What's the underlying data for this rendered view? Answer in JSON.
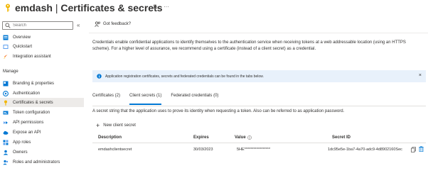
{
  "header": {
    "app_name": "emdash",
    "separator": "|",
    "page_title": "Certificates & secrets",
    "more": "···"
  },
  "sidebar": {
    "search_placeholder": "Search",
    "collapse": "«",
    "section_manage": "Manage",
    "items": [
      {
        "label": "Overview",
        "icon": "overview-icon"
      },
      {
        "label": "Quickstart",
        "icon": "quickstart-icon"
      },
      {
        "label": "Integration assistant",
        "icon": "rocket-icon"
      },
      {
        "label": "Branding & properties",
        "icon": "branding-icon"
      },
      {
        "label": "Authentication",
        "icon": "authentication-icon"
      },
      {
        "label": "Certificates & secrets",
        "icon": "key-icon"
      },
      {
        "label": "Token configuration",
        "icon": "token-icon"
      },
      {
        "label": "API permissions",
        "icon": "permissions-icon"
      },
      {
        "label": "Expose an API",
        "icon": "cloud-icon"
      },
      {
        "label": "App roles",
        "icon": "app-roles-icon"
      },
      {
        "label": "Owners",
        "icon": "owners-icon"
      },
      {
        "label": "Roles and administrators",
        "icon": "roles-icon"
      }
    ]
  },
  "main": {
    "feedback": "Got feedback?",
    "intro": "Credentials enable confidential applications to identify themselves to the authentication service when receiving tokens at a web addressable location (using an HTTPS scheme). For a higher level of assurance, we recommend using a certificate (instead of a client secret) as a credential.",
    "banner": "Application registration certificates, secrets and federated credentials can be found in the tabs below.",
    "banner_close": "×",
    "tabs": [
      {
        "label": "Certificates (2)",
        "active": false
      },
      {
        "label": "Client secrets (1)",
        "active": true
      },
      {
        "label": "Federated credentials (0)",
        "active": false
      }
    ],
    "tab_description": "A secret string that the application uses to prove its identity when requesting a token. Also can be referred to as application password.",
    "new_secret": "New client secret",
    "new_secret_plus": "+",
    "table": {
      "headers": [
        "Description",
        "Expires",
        "Value",
        "Secret ID"
      ],
      "rows": [
        {
          "description": "emdashclientsecret",
          "expires": "30/03/2023",
          "value": "5HE*****************",
          "secret_id": "1dc95e5e-1ba7-4a70-adc9-4d8902160Sec"
        }
      ]
    }
  },
  "colors": {
    "accent": "#0078d4",
    "banner_bg": "#e8f1fb",
    "active_nav": "#edebe9"
  }
}
